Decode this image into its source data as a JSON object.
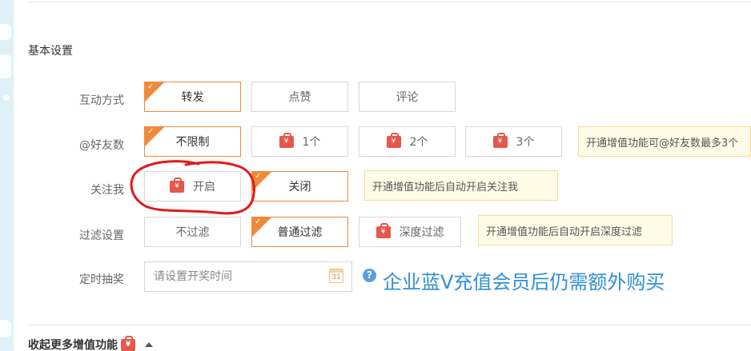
{
  "section_title": "基本设置",
  "rows": {
    "interaction": {
      "label": "互动方式",
      "options": [
        "转发",
        "点赞",
        "评论"
      ]
    },
    "mention": {
      "label": "@好友数",
      "options": [
        "不限制",
        "1个",
        "2个",
        "3个"
      ],
      "tip": "开通增值功能可@好友数最多3个"
    },
    "follow": {
      "label": "关注我",
      "options": [
        "开启",
        "关闭"
      ],
      "tip": "开通增值功能后自动开启关注我"
    },
    "filter": {
      "label": "过滤设置",
      "options": [
        "不过滤",
        "普通过滤",
        "深度过滤"
      ],
      "tip": "开通增值功能后自动开启深度过滤"
    },
    "draw_time": {
      "label": "定时抽奖",
      "placeholder": "请设置开奖时间",
      "calendar_day": "31"
    }
  },
  "premium_badge": "¥",
  "promo_text": "企业蓝V充值会员后仍需额外购买",
  "collapse_label": "收起更多增值功能",
  "colors": {
    "accent": "#f08a3a",
    "premium_red": "#e4584d",
    "promo_blue": "#2f8fd8",
    "tip_bg": "#fffbe6",
    "annotation_red": "#e01b1b"
  },
  "icons": [
    "check-icon",
    "premium-bag-icon",
    "calendar-icon",
    "question-icon",
    "triangle-up-icon"
  ]
}
